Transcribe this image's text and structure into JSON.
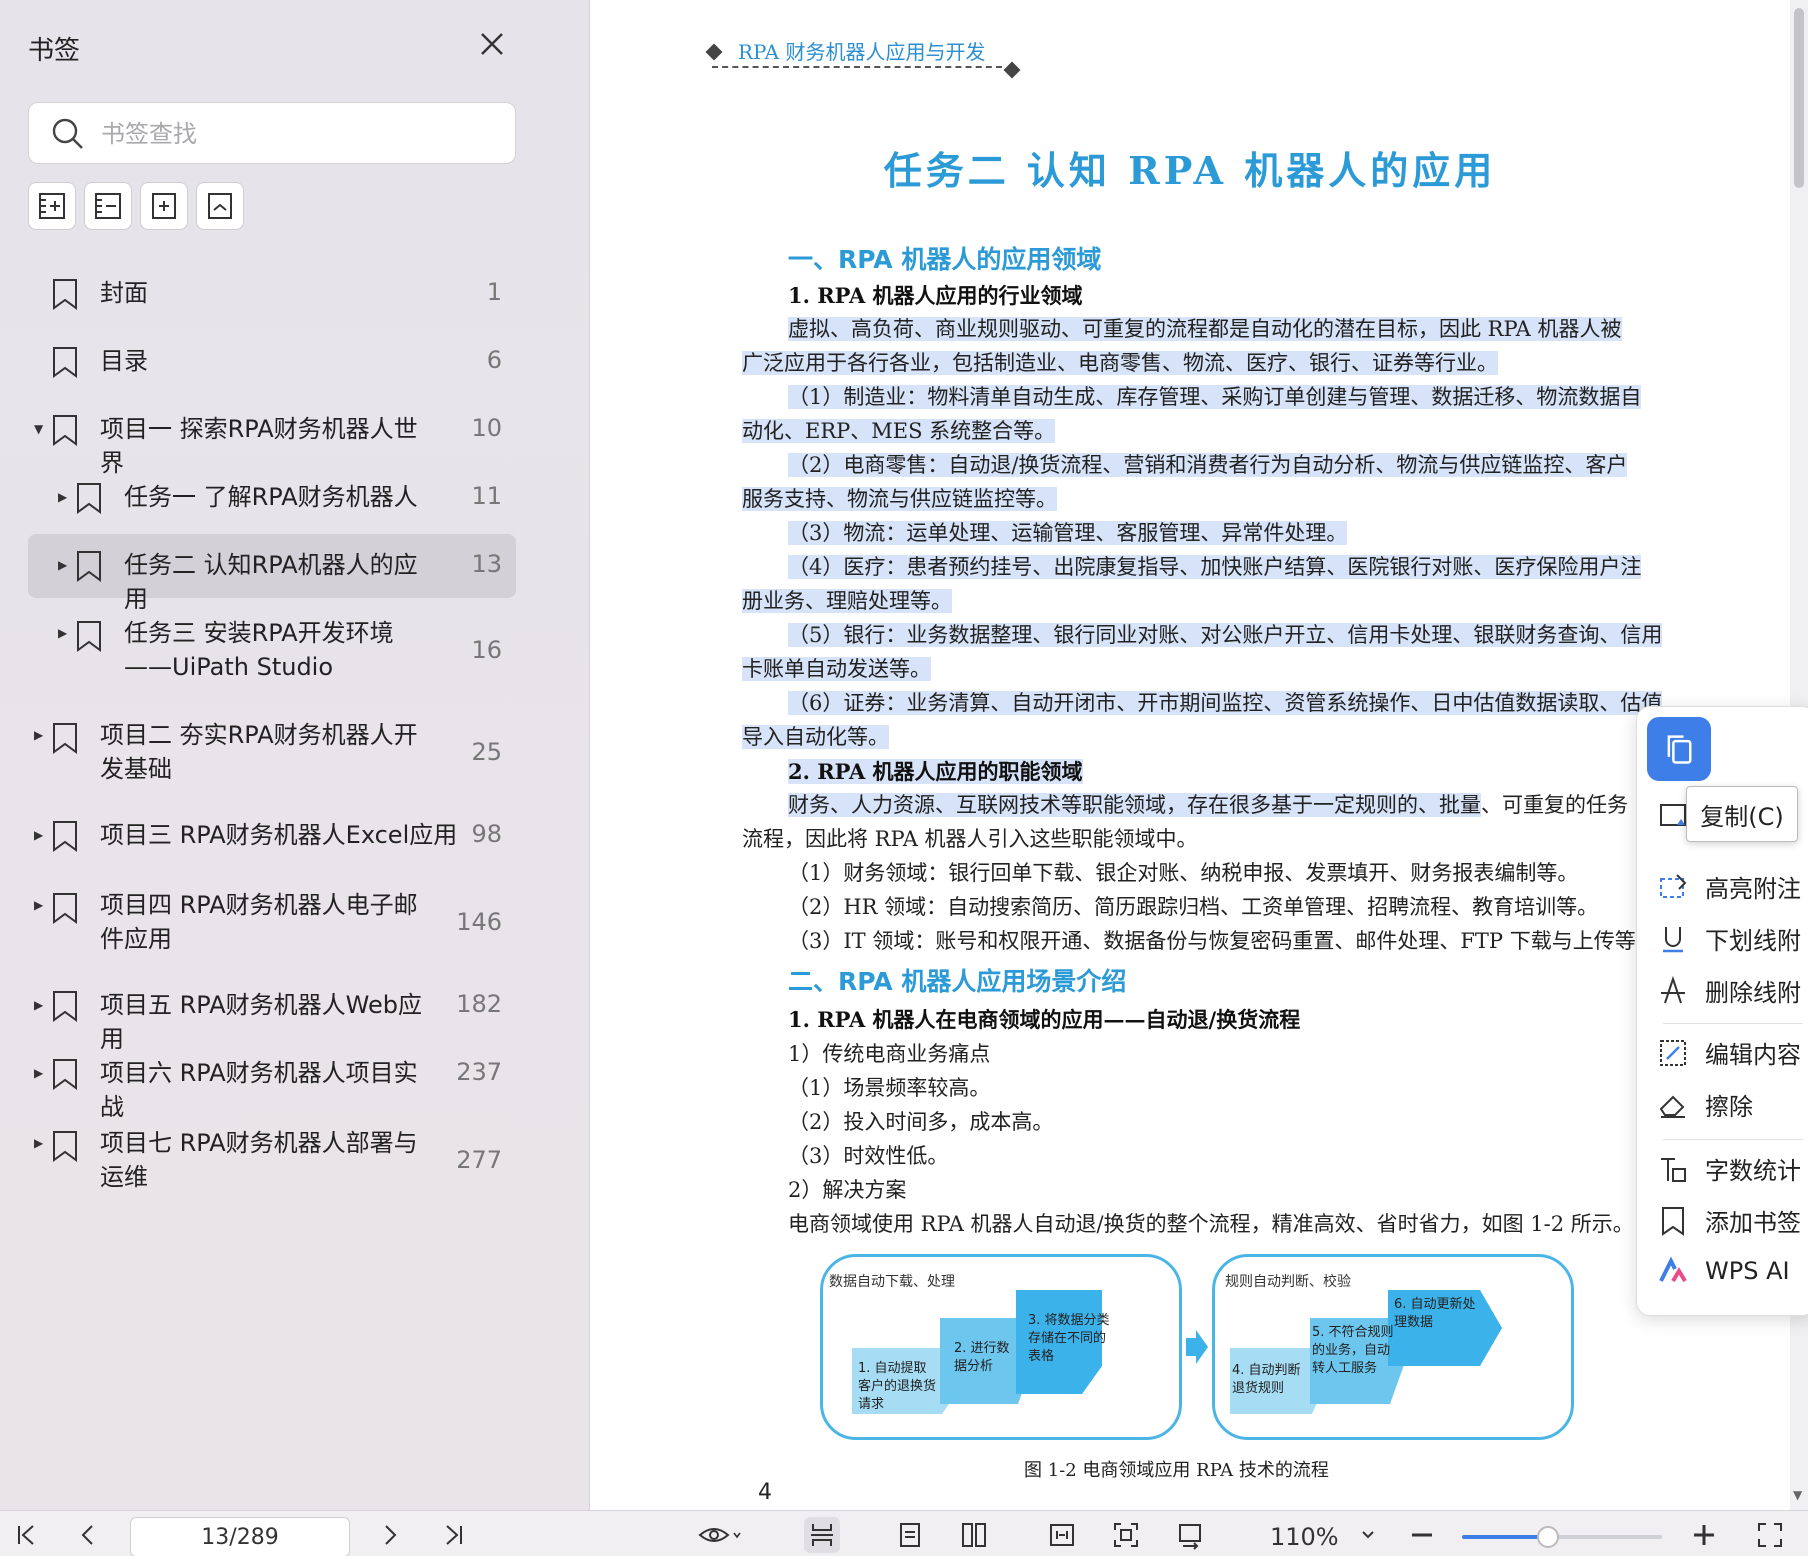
{
  "sidebar": {
    "title": "书签",
    "search_placeholder": "书签查找",
    "items": [
      {
        "label": "封面",
        "page": "1"
      },
      {
        "label": "目录",
        "page": "6"
      },
      {
        "label": "项目一 探索RPA财务机器人世界",
        "page": "10"
      },
      {
        "label": "任务一 了解RPA财务机器人",
        "page": "11"
      },
      {
        "label": "任务二 认知RPA机器人的应用",
        "page": "13"
      },
      {
        "label": "任务三 安装RPA开发环境——UiPath Studio",
        "page": "16"
      },
      {
        "label": "项目二 夯实RPA财务机器人开发基础",
        "page": "25"
      },
      {
        "label": "项目三 RPA财务机器人Excel应用",
        "page": "98"
      },
      {
        "label": "项目四 RPA财务机器人电子邮件应用",
        "page": "146"
      },
      {
        "label": "项目五 RPA财务机器人Web应用",
        "page": "182"
      },
      {
        "label": "项目六 RPA财务机器人项目实战",
        "page": "237"
      },
      {
        "label": "项目七 RPA财务机器人部署与运维",
        "page": "277"
      }
    ]
  },
  "doc": {
    "running_head": "RPA 财务机器人应用与开发",
    "task_title": "任务二  认知 RPA 机器人的应用",
    "sec1": "一、RPA 机器人的应用领域",
    "sub1": "1. RPA 机器人应用的行业领域",
    "p1a": "虚拟、高负荷、商业规则驱动、可重复的流程都是自动化的潜在目标，因此 RPA 机器人被",
    "p1b": "广泛应用于各行各业，包括制造业、电商零售、物流、医疗、银行、证券等行业。",
    "p2a": "（1）制造业：物料清单自动生成、库存管理、采购订单创建与管理、数据迁移、物流数据自",
    "p2b": "动化、ERP、MES 系统整合等。",
    "p3a": "（2）电商零售：自动退/换货流程、营销和消费者行为自动分析、物流与供应链监控、客户",
    "p3b": "服务支持、物流与供应链监控等。",
    "p4": "（3）物流：运单处理、运输管理、客服管理、异常件处理。",
    "p5a": "（4）医疗：患者预约挂号、出院康复指导、加快账户结算、医院银行对账、医疗保险用户注",
    "p5b": "册业务、理赔处理等。",
    "p6a": "（5）银行：业务数据整理、银行同业对账、对公账户开立、信用卡处理、银联财务查询、信用",
    "p6b": "卡账单自动发送等。",
    "p7a": "（6）证券：业务清算、自动开闭市、开市期间监控、资管系统操作、日中估值数据读取、估值",
    "p7b": "导入自动化等。",
    "sub2": "2. RPA 机器人应用的职能领域",
    "p8a": "财务、人力资源、互联网技术等职能领域，存在很多基于一定规则的、批量",
    "p8a_rest": "、可重复的任务",
    "p8b": "流程，因此将 RPA 机器人引入这些职能领域中。",
    "p9": "（1）财务领域：银行回单下载、银企对账、纳税申报、发票填开、财务报表编制等。",
    "p10": "（2）HR 领域：自动搜索简历、简历跟踪归档、工资单管理、招聘流程、教育培训等。",
    "p11": "（3）IT 领域：账号和权限开通、数据备份与恢复密码重置、邮件处理、FTP 下载与上传等。",
    "sec2": "二、RPA 机器人应用场景介绍",
    "sub3": "1. RPA 机器人在电商领域的应用——自动退/换货流程",
    "q1": "1）传统电商业务痛点",
    "q2": "（1）场景频率较高。",
    "q3": "（2）投入时间多，成本高。",
    "q4": "（3）时效性低。",
    "q5": "2）解决方案",
    "q6": "电商领域使用 RPA 机器人自动退/换货的整个流程，精准高效、省时省力，如图 1-2 所示。",
    "fig": {
      "left_head": "数据自动下载、处理",
      "right_head": "规则自动判断、校验",
      "s1": "1. 自动提取客户的退换货请求",
      "s2": "2. 进行数据分析",
      "s3": "3. 将数据分类存储在不同的表格",
      "s4": "4. 自动判断退货规则",
      "s5": "5. 不符合规则的业务，自动转人工服务",
      "s6": "6. 自动更新处理数据",
      "caption": "图 1-2   电商领域应用 RPA 技术的流程"
    },
    "page_number": "4"
  },
  "context_menu": {
    "tooltip": "复制(C)",
    "items": [
      "高亮附注",
      "下划线附",
      "删除线附",
      "编辑内容",
      "擦除",
      "字数统计",
      "添加书签",
      "WPS AI"
    ]
  },
  "bottom": {
    "page_indicator": "13/289",
    "zoom": "110%",
    "zoom_fraction": 0.43
  },
  "colors": {
    "accent": "#3d7ee8",
    "heading_blue": "#2b9ad6",
    "highlight": "#d7e3f8"
  }
}
